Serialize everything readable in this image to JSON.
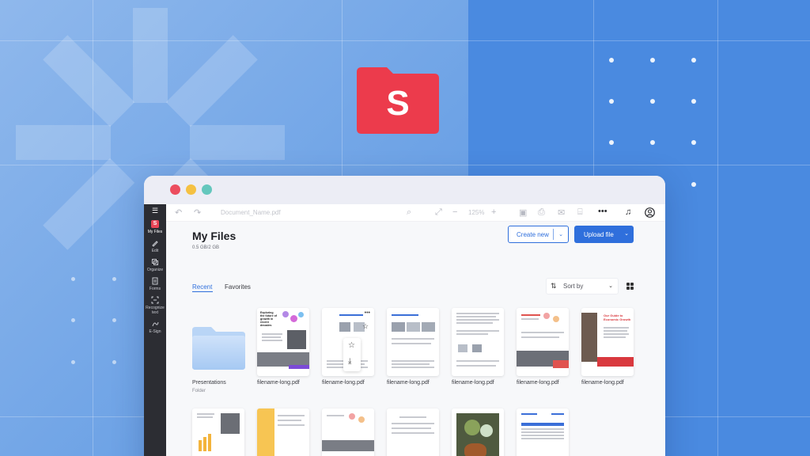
{
  "window": {
    "doc_name": "Document_Name.pdf",
    "zoom": "125%"
  },
  "logo": {
    "letter": "S"
  },
  "sidebar": {
    "items": [
      {
        "label": "My Files",
        "icon": "folder-icon"
      },
      {
        "label": "Edit",
        "icon": "pen-icon"
      },
      {
        "label": "Organize",
        "icon": "organize-icon"
      },
      {
        "label": "Forms",
        "icon": "form-icon"
      },
      {
        "label": "Recognize text",
        "icon": "ocr-icon"
      },
      {
        "label": "E-Sign",
        "icon": "sign-icon"
      }
    ]
  },
  "page": {
    "title": "My Files",
    "storage": "0.5 GB/2 GB",
    "create_label": "Create new",
    "upload_label": "Upload file",
    "tabs": [
      "Recent",
      "Favorites"
    ],
    "sort_label": "Sort by"
  },
  "folder": {
    "name": "Presentations",
    "type": "Folder"
  },
  "files": [
    {
      "name": "filename-long.pdf"
    },
    {
      "name": "filename-long.pdf"
    },
    {
      "name": "filename-long.pdf"
    },
    {
      "name": "filename-long.pdf"
    },
    {
      "name": "filename-long.pdf"
    },
    {
      "name": "filename-long.pdf"
    }
  ],
  "thumb_texts": {
    "t1": "Exploring the future of growth in recent decades",
    "t6": "Our Guide to Economic Growth"
  },
  "colors": {
    "accent": "#2f6fdc",
    "brand": "#ec3b4c",
    "sidebar": "#2c2d33"
  }
}
